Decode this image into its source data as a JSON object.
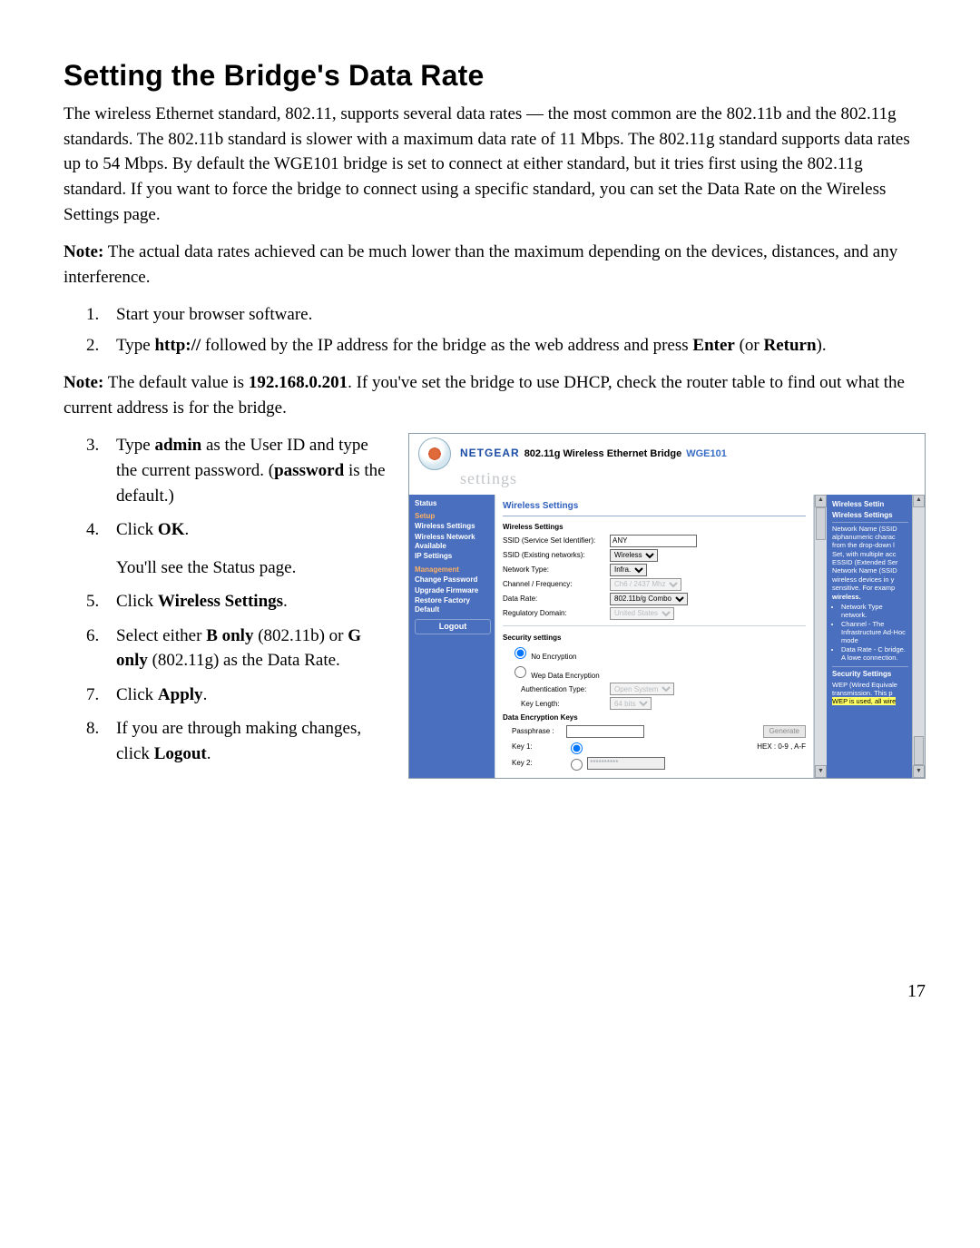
{
  "page_number": "17",
  "title": "Setting the Bridge's Data Rate",
  "intro": "The wireless Ethernet standard, 802.11, supports several data rates — the most common are the 802.11b and the 802.11g standards. The 802.11b standard is slower with a maximum data rate of 11 Mbps. The 802.11g standard supports data rates up to 54 Mbps. By default the WGE101 bridge is set to connect at either standard, but it tries first using the 802.11g standard. If you want to force the bridge to connect using a specific standard, you can set the Data Rate on the Wireless Settings page.",
  "note1_label": "Note:",
  "note1": " The actual data rates achieved can be much lower than the maximum depending on the devices, distances, and any interference.",
  "step1": "Start your browser software.",
  "step2_a": "Type ",
  "step2_b": "http://",
  "step2_c": " followed by the IP address for the bridge as the web address and press ",
  "step2_d": "Enter",
  "step2_e": " (or ",
  "step2_f": "Return",
  "step2_g": ").",
  "note2_label": "Note:",
  "note2_a": " The default value is ",
  "note2_b": "192.168.0.201",
  "note2_c": ". If you've set the bridge to use DHCP, check the router table to find out what the current address is for the bridge.",
  "step3_a": "Type ",
  "step3_b": "admin",
  "step3_c": " as the User ID and type the current password. (",
  "step3_d": "password",
  "step3_e": " is the default.)",
  "step4_a": "Click ",
  "step4_b": "OK",
  "step4_c": ".",
  "step4_sub": "You'll see the Status page.",
  "step5_a": "Click ",
  "step5_b": "Wireless Settings",
  "step5_c": ".",
  "step6_a": "Select either ",
  "step6_b": "B only",
  "step6_c": " (802.11b) or ",
  "step6_d": "G only",
  "step6_e": " (802.11g) as the Data Rate.",
  "step7_a": "Click ",
  "step7_b": "Apply",
  "step7_c": ".",
  "step8_a": "If you are through making changes, click ",
  "step8_b": "Logout",
  "step8_c": ".",
  "ss": {
    "brand": "NETGEAR",
    "title": "802.11g Wireless Ethernet Bridge",
    "model": "WGE101",
    "subheader": "settings",
    "nav": {
      "status": "Status",
      "setup": "Setup",
      "wireless_settings": "Wireless Settings",
      "wireless_network": "Wireless Network Available",
      "ip_settings": "IP Settings",
      "management": "Management",
      "change_password": "Change Password",
      "upgrade_firmware": "Upgrade Firmware",
      "restore_factory": "Restore Factory Default",
      "logout": "Logout"
    },
    "main": {
      "heading": "Wireless Settings",
      "subheading": "Wireless Settings",
      "ssid_label": "SSID (Service Set Identifier):",
      "ssid_value": "ANY",
      "ssid_exist_label": "SSID (Existing networks):",
      "ssid_exist_value": "Wireless",
      "net_type_label": "Network Type:",
      "net_type_value": "Infra.",
      "chan_label": "Channel / Frequency:",
      "chan_value": "Ch6 / 2437 Mhz",
      "rate_label": "Data Rate:",
      "rate_value": "802.11b/g Combo",
      "domain_label": "Regulatory Domain:",
      "domain_value": "United States",
      "sec_heading": "Security settings",
      "no_enc": "No Encryption",
      "wep": "Wep Data Encryption",
      "auth_label": "Authentication Type:",
      "auth_value": "Open System",
      "keylen_label": "Key Length:",
      "keylen_value": "64 bits",
      "keys_heading": "Data Encryption Keys",
      "pass_label": "Passphrase :",
      "generate": "Generate",
      "key1": "Key 1:",
      "key2": "Key 2:",
      "hex": "HEX : 0-9 , A-F",
      "masked": "**********"
    },
    "help": {
      "h1": "Wireless Settin",
      "h2": "Wireless Settings",
      "p1": "Network Name (SSID alphanumeric charac from the drop-down l Set, with multiple acc ESSID (Extended Ser Network Name (SSID wireless devices in y sensitive. For examp",
      "p1b": "wireless.",
      "li1": "Network Type network.",
      "li2": "Channel - The Infrastructure Ad-Hoc mode",
      "li3": "Data Rate - C bridge. A lowe connection.",
      "h3": "Security Settings",
      "p2a": "WEP (Wired Equivale",
      "p2b": "transmission. This p",
      "p2c": "WEP is used, all wire"
    }
  }
}
